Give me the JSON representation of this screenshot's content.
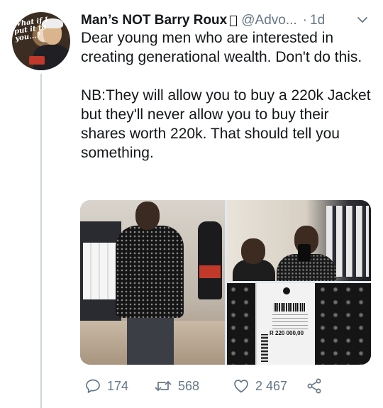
{
  "author": {
    "display_name": "Man’s NOT Barry Roux",
    "handle": "@Advo...",
    "separator": "·",
    "time": "1d",
    "avatar_caption": "What if I put it to you...?",
    "avatar_icon": "profile-photo"
  },
  "tweet": {
    "text": "Dear young men who are interested in creating generational wealth. Don't do this.\n\nNB:They will allow you to buy a 220k Jacket but they'll never allow you to buy their shares worth 220k. That should tell you something."
  },
  "media": {
    "price_tag": "R 220 000,00",
    "photos": [
      "photo-man-in-jacket",
      "photo-mirror-selfie",
      "photo-price-tag"
    ]
  },
  "actions": {
    "reply_count": "174",
    "retweet_count": "568",
    "like_count": "2 467",
    "icons": [
      "reply-icon",
      "retweet-icon",
      "like-icon",
      "share-icon"
    ]
  },
  "colors": {
    "text": "#14171a",
    "secondary": "#657786",
    "thread_line": "#ccd6dd"
  }
}
